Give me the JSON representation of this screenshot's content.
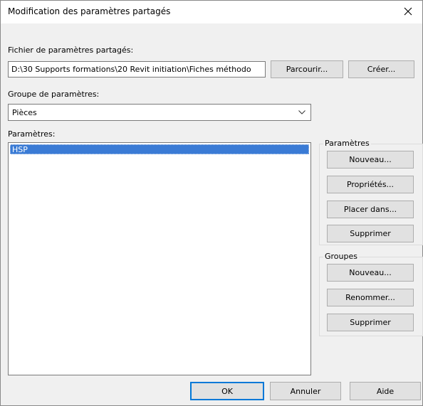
{
  "window": {
    "title": "Modification des paramètres partagés",
    "close_icon": "close-icon"
  },
  "shared_file": {
    "label": "Fichier de paramètres partagés:",
    "value": "D:\\30 Supports formations\\20 Revit initiation\\Fiches méthodo",
    "browse_label": "Parcourir...",
    "create_label": "Créer..."
  },
  "group_select": {
    "label": "Groupe de paramètres:",
    "value": "Pièces",
    "arrow_icon": "chevron-down-icon"
  },
  "parameters": {
    "label": "Paramètres:",
    "items": [
      "HSP"
    ],
    "selected": "HSP"
  },
  "param_group": {
    "title": "Paramètres",
    "new_label": "Nouveau...",
    "props_label": "Propriétés...",
    "move_label": "Placer dans...",
    "delete_label": "Supprimer"
  },
  "groups_group": {
    "title": "Groupes",
    "new_label": "Nouveau...",
    "rename_label": "Renommer...",
    "delete_label": "Supprimer"
  },
  "footer": {
    "ok_label": "OK",
    "cancel_label": "Annuler",
    "help_label": "Aide"
  },
  "colors": {
    "selection": "#3a7bd5",
    "default_button_border": "#0078d7"
  }
}
